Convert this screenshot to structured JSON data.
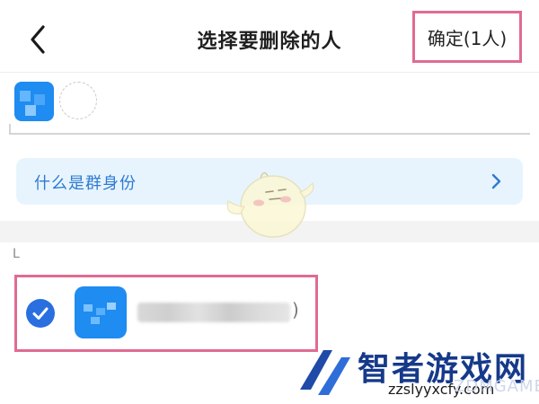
{
  "header": {
    "back_icon": "chevron-left-icon",
    "title": "选择要删除的人",
    "confirm_label": "确定(1人)",
    "highlight_color": "#e06b93"
  },
  "selected_members": {
    "count": 1
  },
  "info_banner": {
    "text": "什么是群身份",
    "text_color": "#2d7bd1",
    "background": "#e8f4fd",
    "icon": "chevron-right-icon"
  },
  "member_list": {
    "section_letter": "L",
    "items": [
      {
        "selected": true,
        "name_tail": ")",
        "check_color": "#2a6fe0"
      }
    ]
  },
  "watermark": {
    "title": "智者游戏网",
    "subtitle": "zzslyyxcfy.com",
    "ghost_text": "ZDMGAME"
  }
}
